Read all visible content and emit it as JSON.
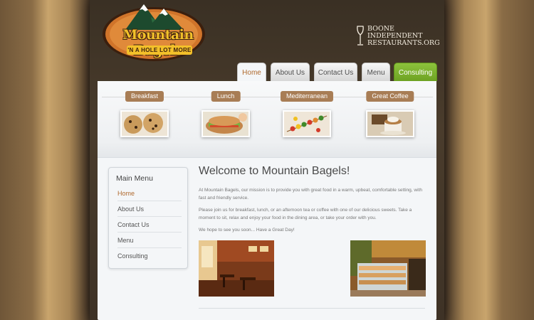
{
  "logo": {
    "title": "Mountain Bagels",
    "tagline": "'N A HOLE LOT MORE"
  },
  "boone": {
    "line1": "BOONE",
    "line2": "INDEPENDENT",
    "line3": "RESTAURANTS.ORG"
  },
  "nav": {
    "tabs": [
      {
        "label": "Home"
      },
      {
        "label": "About Us"
      },
      {
        "label": "Contact Us"
      },
      {
        "label": "Menu"
      },
      {
        "label": "Consulting"
      }
    ]
  },
  "categories": [
    {
      "label": "Breakfast",
      "image": "cookies"
    },
    {
      "label": "Lunch",
      "image": "sandwich"
    },
    {
      "label": "Mediterranean",
      "image": "kebabs"
    },
    {
      "label": "Great Coffee",
      "image": "coffee"
    }
  ],
  "sidebar": {
    "title": "Main Menu",
    "items": [
      {
        "label": "Home"
      },
      {
        "label": "About Us"
      },
      {
        "label": "Contact Us"
      },
      {
        "label": "Menu"
      },
      {
        "label": "Consulting"
      }
    ]
  },
  "main": {
    "title": "Welcome to Mountain Bagels!",
    "paragraphs": [
      "At Mountain Bagels, our mission is to provide you with great food in a warm, upbeat, comfortable setting, with fast and friendly service.",
      "Please join us for breakfast, lunch, or an afternoon tea or coffee with one of our delicious sweets. Take a moment to sit, relax and enjoy your food in the dining area, or take your order with you.",
      "We hope to see you soon... Have a Great Day!"
    ]
  },
  "colors": {
    "accent_brown": "#a87d55",
    "active_link": "#b06a2e",
    "green_tab": "#7ab02c",
    "logo_yellow": "#f3c02a"
  }
}
